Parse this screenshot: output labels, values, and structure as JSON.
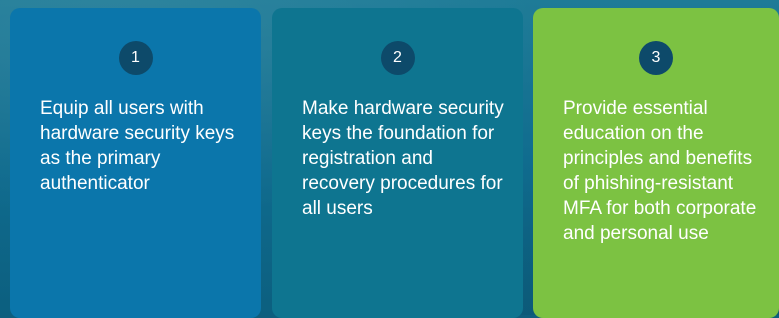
{
  "colors": {
    "card_1_bg": "#0b76ab",
    "card_2_bg": "#0e7590",
    "card_3_bg": "#7cc242",
    "badge_bg": "#0d4a6a",
    "text": "#ffffff"
  },
  "steps": [
    {
      "number": "1",
      "text": "Equip all users with hardware security keys as the primary authenticator"
    },
    {
      "number": "2",
      "text": "Make hardware security keys the foundation for registration and recovery procedures for all users"
    },
    {
      "number": "3",
      "text": "Provide essential education on the principles and benefits of phishing-resistant MFA for both corporate and personal use"
    }
  ]
}
